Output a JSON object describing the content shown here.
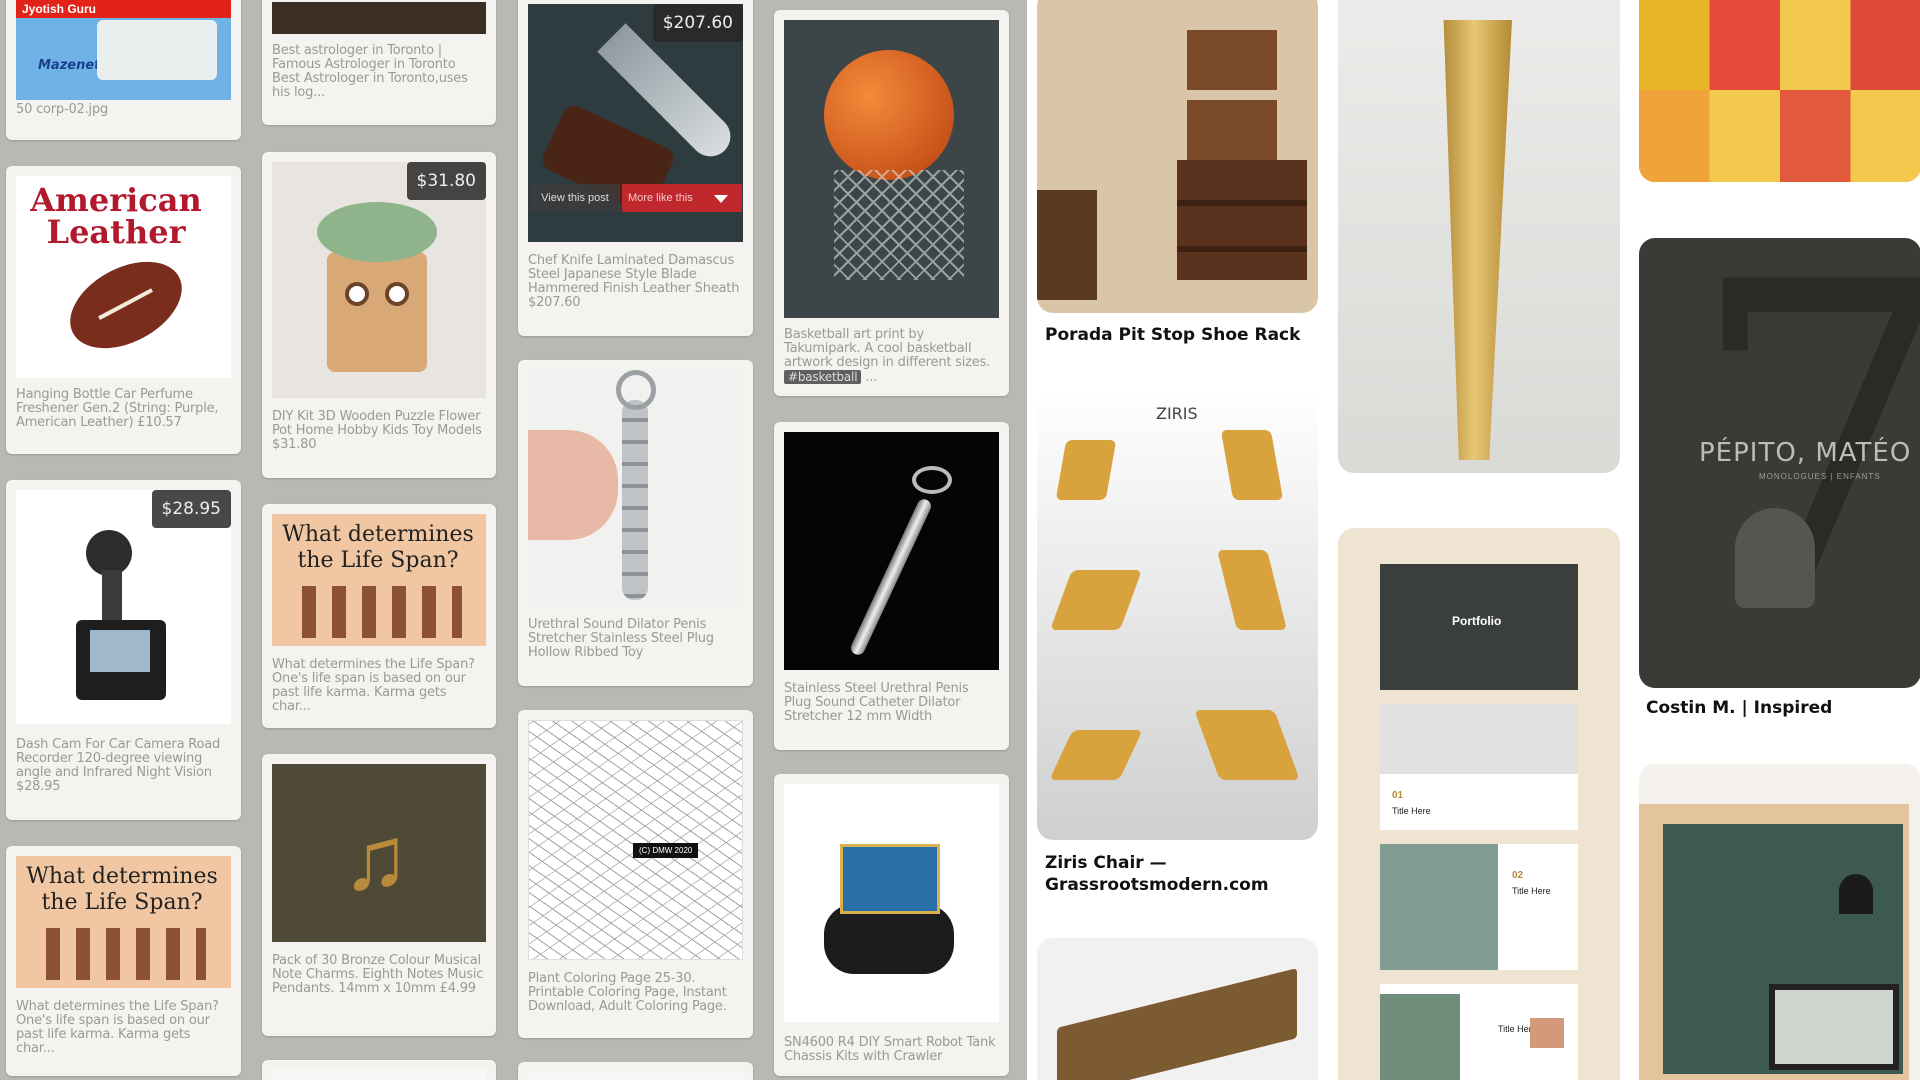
{
  "left_cards": [
    {
      "caption": "50 corp-02.jpg",
      "logo": "Mazenet",
      "banner": "Jyotish Guru"
    },
    {
      "caption": "Hanging Bottle Car Perfume Freshener Gen.2 (String: Purple, American Leather) £10.57",
      "title": "American Leather"
    },
    {
      "caption": "Dash Cam For Car Camera Road Recorder 120-degree viewing angle and Infrared Night Vision $28.95",
      "price": "$28.95"
    },
    {
      "caption": "What determines the Life Span? One's life span is based on our past life karma. Karma gets char...",
      "title": "What determines the Life Span?"
    },
    {
      "caption": "Best astrologer in Toronto | Famous Astrologer in Toronto Best Astrologer in Toronto,uses his log..."
    },
    {
      "caption": "DIY Kit 3D Wooden Puzzle Flower Pot Home Hobby Kids Toy Models $31.80",
      "price": "$31.80"
    },
    {
      "caption": "What determines the Life Span? One's life span is based on our past life karma. Karma gets char...",
      "title": "What determines the Life Span?"
    },
    {
      "caption": "Pack of 30 Bronze Colour Musical Note Charms. Eighth Notes Music Pendants. 14mm x 10mm £4.99"
    },
    {
      "caption": "Chef Knife Laminated Damascus Steel Japanese Style Blade Hammered Finish Leather Sheath $207.60",
      "price": "$207.60",
      "view_label": "View this post",
      "more_label": "More like this"
    },
    {
      "caption": "Urethral Sound Dilator Penis Stretcher Stainless Steel Plug Hollow Ribbed Toy"
    },
    {
      "caption": "Plant Coloring Page 25-30. Printable Coloring Page, Instant Download, Adult Coloring Page.",
      "stamp": "(C) DMW 2020"
    },
    {
      "caption": "Basketball art print by Takumipark. A cool basketball artwork design in different sizes.",
      "tag": "#basketball",
      "tail": "..."
    },
    {
      "caption": "Stainless Steel Urethral Penis Plug Sound Catheter Dilator Stretcher 12 mm Width"
    },
    {
      "caption": "SN4600 R4 DIY Smart Robot Tank Chassis Kits with Crawler"
    }
  ],
  "right_cards": [
    {
      "title": "Porada Pit Stop Shoe Rack"
    },
    {
      "title": "Ziris Chair — Grassrootsmodern.com",
      "brand": "ZIRIS"
    },
    {
      "title": ""
    },
    {
      "title": ""
    },
    {
      "title": "",
      "slides": [
        {
          "label": "Portfolio"
        },
        {
          "num": "01",
          "label": "Title Here"
        },
        {
          "num": "02",
          "label": "Title Here"
        },
        {
          "num": "",
          "label": "Title Here"
        }
      ]
    },
    {
      "title": ""
    },
    {
      "title": "Costin M. | Inspired",
      "poster": "PÉPITO, MATÉO",
      "poster_sub": "MONOLOGUES | ENFANTS",
      "big_num": "7"
    },
    {
      "title": ""
    }
  ],
  "colors": {
    "board": "#b9b9b3",
    "card": "#f4f3ef",
    "caption": "#9a9a94",
    "more_button": "#c0282e"
  }
}
